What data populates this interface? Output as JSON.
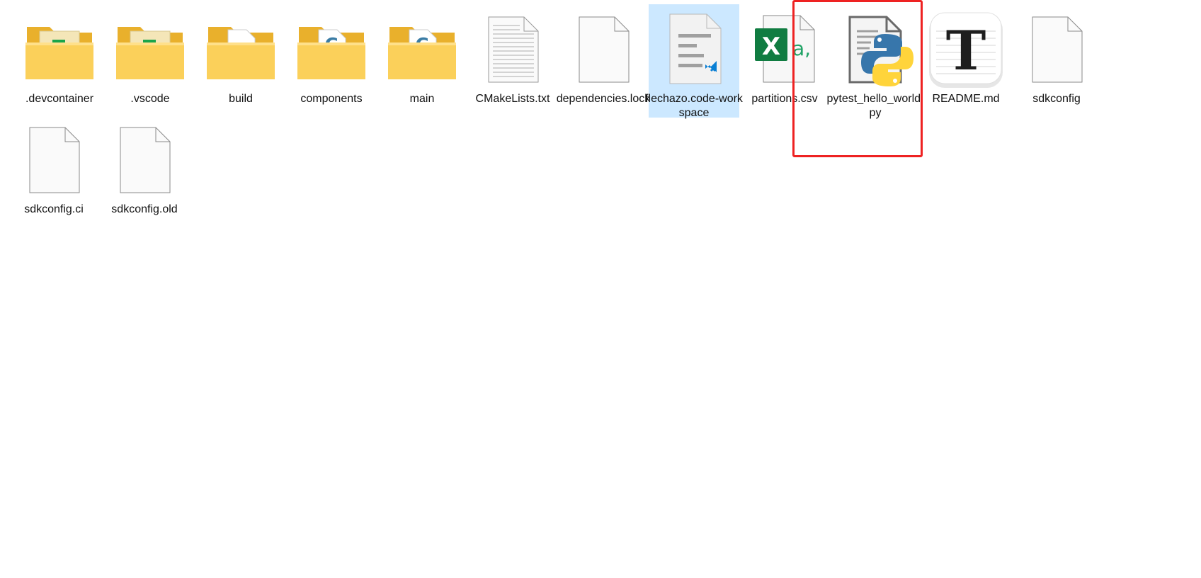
{
  "files": [
    {
      "name": ".devcontainer",
      "icon": "folder-devcontainer-icon"
    },
    {
      "name": ".vscode",
      "icon": "folder-vscode-icon"
    },
    {
      "name": "build",
      "icon": "folder-build-icon"
    },
    {
      "name": "components",
      "icon": "folder-c-icon"
    },
    {
      "name": "main",
      "icon": "folder-c-icon"
    },
    {
      "name": "CMakeLists.txt",
      "icon": "text-file-icon"
    },
    {
      "name": "dependencies.lock",
      "icon": "blank-file-icon"
    },
    {
      "name": "flechazo.code-workspace",
      "icon": "vscode-workspace-icon",
      "selected": true
    },
    {
      "name": "partitions.csv",
      "icon": "excel-csv-icon",
      "highlighted": true
    },
    {
      "name": "pytest_hello_world.py",
      "icon": "python-file-icon"
    },
    {
      "name": "README.md",
      "icon": "typora-markdown-icon"
    },
    {
      "name": "sdkconfig",
      "icon": "blank-file-icon"
    },
    {
      "name": "sdkconfig.ci",
      "icon": "blank-file-icon"
    },
    {
      "name": "sdkconfig.old",
      "icon": "blank-file-icon"
    }
  ],
  "colors": {
    "selection_bg": "#cce8ff",
    "highlight_border": "#ee2222",
    "folder_yellow": "#f8c43f",
    "excel_green": "#107c41",
    "python_blue": "#3776ab",
    "python_yellow": "#ffd43b"
  }
}
